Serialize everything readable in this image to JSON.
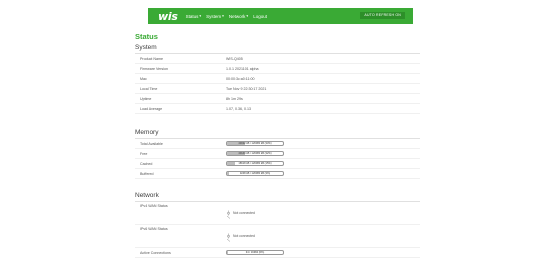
{
  "header": {
    "logo": "wis",
    "menu": [
      {
        "label": "Status",
        "caret": "▾"
      },
      {
        "label": "System",
        "caret": "▾"
      },
      {
        "label": "Network",
        "caret": "▾"
      },
      {
        "label": "Logout",
        "caret": ""
      }
    ],
    "refresh_label": "AUTO REFRESH ON",
    "accent_color": "#3aaa35"
  },
  "page": {
    "title": "Status"
  },
  "system": {
    "heading": "System",
    "rows": [
      {
        "key": "Product Name",
        "value": "WIS-Q405"
      },
      {
        "key": "Firmware Version",
        "value": "1.0.1 2021101 alpha"
      },
      {
        "key": "Mac",
        "value": "00:00:3c:a0:11:00"
      },
      {
        "key": "Local Time",
        "value": "Tue Nov 9 22:30:17 2021"
      },
      {
        "key": "Uptime",
        "value": "8h 1m 29s"
      },
      {
        "key": "Load Average",
        "value": "1.07, 0.36, 0.13"
      }
    ]
  },
  "memory": {
    "heading": "Memory",
    "rows": [
      {
        "key": "Total Available",
        "text": "43022 kB / 126080 kB (33%)",
        "fraction": 0.33
      },
      {
        "key": "Free",
        "text": "40140 kB / 126080 kB (32%)",
        "fraction": 0.32
      },
      {
        "key": "Cached",
        "text": "18618 kB / 126080 kB (15%)",
        "fraction": 0.15
      },
      {
        "key": "Buffered",
        "text": "3248 kB / 126080 kB (3%)",
        "fraction": 0.03
      }
    ]
  },
  "network": {
    "heading": "Network",
    "rows": [
      {
        "key": "IPv4 WAN Status",
        "status": "Not connected",
        "icon": "plug-icon"
      },
      {
        "key": "IPv6 WAN Status",
        "status": "Not connected",
        "icon": "plug-icon"
      }
    ],
    "connections": {
      "key": "Active Connections",
      "text": "34 / 16384 (0%)",
      "fraction": 0.002
    }
  }
}
